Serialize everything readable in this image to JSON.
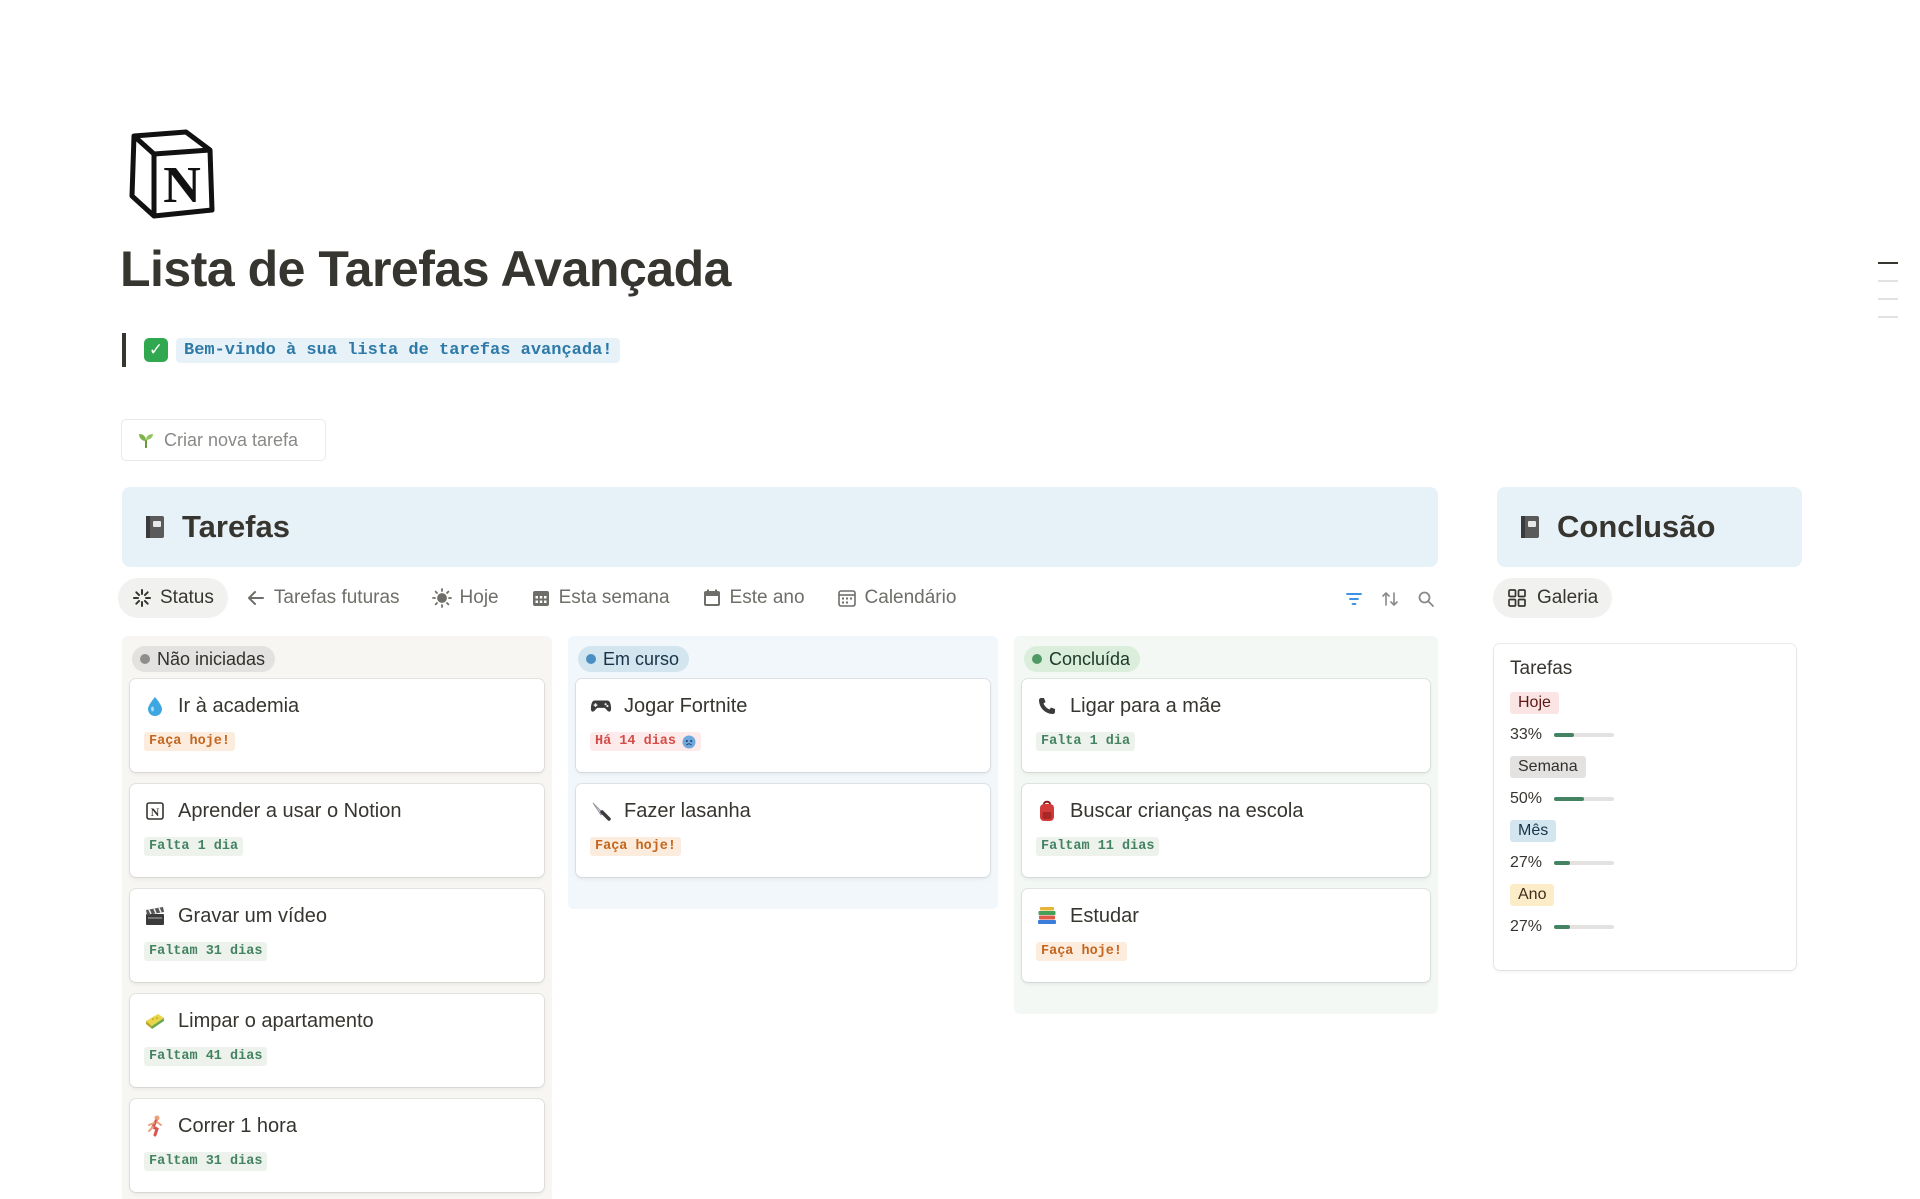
{
  "page": {
    "title": "Lista de Tarefas Avançada",
    "icon": "notion-logo-icon",
    "callout_text": "Bem-vindo à sua lista de tarefas avançada!",
    "new_task_label": "Criar nova tarefa"
  },
  "tasks_db": {
    "title": "Tarefas",
    "tabs": [
      {
        "label": "Status",
        "icon": "loading-spark-icon",
        "active": true
      },
      {
        "label": "Tarefas futuras",
        "icon": "arrow-left-icon"
      },
      {
        "label": "Hoje",
        "icon": "sun-icon"
      },
      {
        "label": "Esta semana",
        "icon": "calendar-grid-icon"
      },
      {
        "label": "Este ano",
        "icon": "calendar-icon"
      },
      {
        "label": "Calendário",
        "icon": "calendar-month-icon"
      }
    ],
    "columns": [
      {
        "label": "Não iniciadas",
        "cards": [
          {
            "title": "Ir à academia",
            "icon": "droplet-icon",
            "tag": "Faça hoje!",
            "tag_color": "orange"
          },
          {
            "title": "Aprender a usar o Notion",
            "icon": "notion-icon",
            "tag": "Falta 1 dia",
            "tag_color": "green"
          },
          {
            "title": "Gravar um vídeo",
            "icon": "clapperboard-icon",
            "tag": "Faltam 31 dias",
            "tag_color": "green"
          },
          {
            "title": "Limpar o apartamento",
            "icon": "sponge-icon",
            "tag": "Faltam 41 dias",
            "tag_color": "green"
          },
          {
            "title": "Correr 1 hora",
            "icon": "runner-icon",
            "tag": "Faltam 31 dias",
            "tag_color": "green"
          }
        ]
      },
      {
        "label": "Em curso",
        "cards": [
          {
            "title": "Jogar Fortnite",
            "icon": "game-controller-icon",
            "tag": "Há 14 dias",
            "tag_color": "red",
            "extra_icon": "worried-face-icon"
          },
          {
            "title": "Fazer lasanha",
            "icon": "knife-icon",
            "tag": "Faça hoje!",
            "tag_color": "orange"
          }
        ]
      },
      {
        "label": "Concluída",
        "cards": [
          {
            "title": "Ligar para a mãe",
            "icon": "telephone-icon",
            "tag": "Falta 1 dia",
            "tag_color": "green"
          },
          {
            "title": "Buscar crianças na escola",
            "icon": "backpack-icon",
            "tag": "Faltam 11 dias",
            "tag_color": "green"
          },
          {
            "title": "Estudar",
            "icon": "books-icon",
            "tag": "Faça hoje!",
            "tag_color": "orange"
          }
        ]
      }
    ]
  },
  "completion_db": {
    "title": "Conclusão",
    "view_label": "Galeria",
    "card_title": "Tarefas",
    "stats": [
      {
        "label": "Hoje",
        "percent_text": "33%",
        "value": 0.33,
        "bg": "#fbe4e4",
        "fg": "#5d1715"
      },
      {
        "label": "Semana",
        "percent_text": "50%",
        "value": 0.5,
        "bg": "#e3e2e0",
        "fg": "#32302c"
      },
      {
        "label": "Mês",
        "percent_text": "27%",
        "value": 0.27,
        "bg": "#d3e5ef",
        "fg": "#183347"
      },
      {
        "label": "Ano",
        "percent_text": "27%",
        "value": 0.27,
        "bg": "#fdecc8",
        "fg": "#402c1b"
      }
    ]
  }
}
